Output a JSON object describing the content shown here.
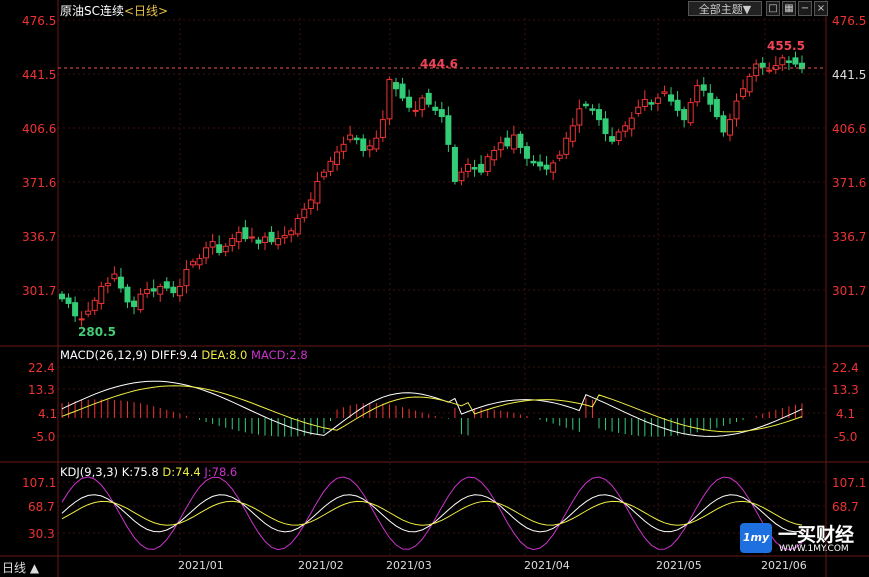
{
  "header": {
    "title": "原油SC连续",
    "period_link": "<日线>",
    "theme_select": "全部主题▼",
    "buttons": [
      {
        "icon": "square-icon",
        "glyph": "□"
      },
      {
        "icon": "grid-icon",
        "glyph": "▦"
      },
      {
        "icon": "minus-icon",
        "glyph": "−"
      },
      {
        "icon": "close-icon",
        "glyph": "×"
      }
    ]
  },
  "colors": {
    "up": "#ee3333",
    "down": "#33cc77",
    "diff": "#ffffff",
    "dea": "#eeee44",
    "j": "#cc33cc",
    "grid": "#3a1010",
    "dashed": "#ee5555"
  },
  "price_axis": {
    "labels": [
      "476.5",
      "441.5",
      "406.6",
      "371.6",
      "336.7",
      "301.7"
    ],
    "current": "441.5"
  },
  "annotations": {
    "high_mid": "444.6",
    "high_right": "455.5",
    "low": "280.5"
  },
  "x_axis": {
    "labels": [
      "2021/01",
      "2021/02",
      "2021/03",
      "2021/04",
      "2021/05",
      "2021/06"
    ]
  },
  "macd": {
    "name": "MACD(26,12,9)",
    "diff": "DIFF:9.4",
    "dea": "DEA:8.0",
    "macd": "MACD:2.8",
    "axis": [
      "22.4",
      "13.3",
      "4.1",
      "-5.0"
    ]
  },
  "kdj": {
    "name": "KDJ(9,3,3)",
    "k": "K:75.8",
    "d": "D:74.4",
    "j": "J:78.6",
    "axis": [
      "107.1",
      "68.7",
      "30.3"
    ]
  },
  "period_selector": "日线 ▲",
  "logo": {
    "glyph": "1my",
    "name": "一买财经",
    "url": "WWW.1MY.COM"
  },
  "chart_data": {
    "type": "candlestick",
    "title": "原油SC连续",
    "y_ticks": [
      476.5,
      441.5,
      406.6,
      371.6,
      336.7,
      301.7
    ],
    "ylim": [
      280,
      480
    ],
    "x_ticks": [
      "2021/01",
      "2021/02",
      "2021/03",
      "2021/04",
      "2021/05",
      "2021/06"
    ],
    "close": [
      296,
      293,
      285,
      283,
      288,
      295,
      304,
      306,
      312,
      303,
      294,
      291,
      299,
      302,
      301,
      304,
      303,
      300,
      304,
      315,
      320,
      322,
      329,
      333,
      326,
      330,
      335,
      339,
      335,
      336,
      332,
      336,
      333,
      335,
      337,
      340,
      348,
      354,
      360,
      372,
      378,
      385,
      391,
      396,
      402,
      399,
      392,
      395,
      400,
      412,
      438,
      432,
      426,
      420,
      418,
      426,
      422,
      418,
      414,
      396,
      372,
      378,
      383,
      380,
      378,
      388,
      392,
      397,
      395,
      402,
      394,
      387,
      384,
      382,
      380,
      384,
      389,
      400,
      408,
      419,
      421,
      418,
      412,
      403,
      398,
      404,
      408,
      413,
      420,
      425,
      422,
      426,
      430,
      424,
      418,
      412,
      423,
      434,
      431,
      422,
      414,
      404,
      412,
      424,
      432,
      440,
      448,
      446,
      444,
      447,
      452,
      449,
      448,
      445
    ],
    "macd": {
      "axis_ticks": [
        22.4,
        13.3,
        4.1,
        -5.0
      ],
      "diff_last": 9.4,
      "dea_last": 8.0,
      "macd_last": 2.8
    },
    "kdj": {
      "axis_ticks": [
        107.1,
        68.7,
        30.3
      ],
      "k_last": 75.8,
      "d_last": 74.4,
      "j_last": 78.6
    }
  }
}
